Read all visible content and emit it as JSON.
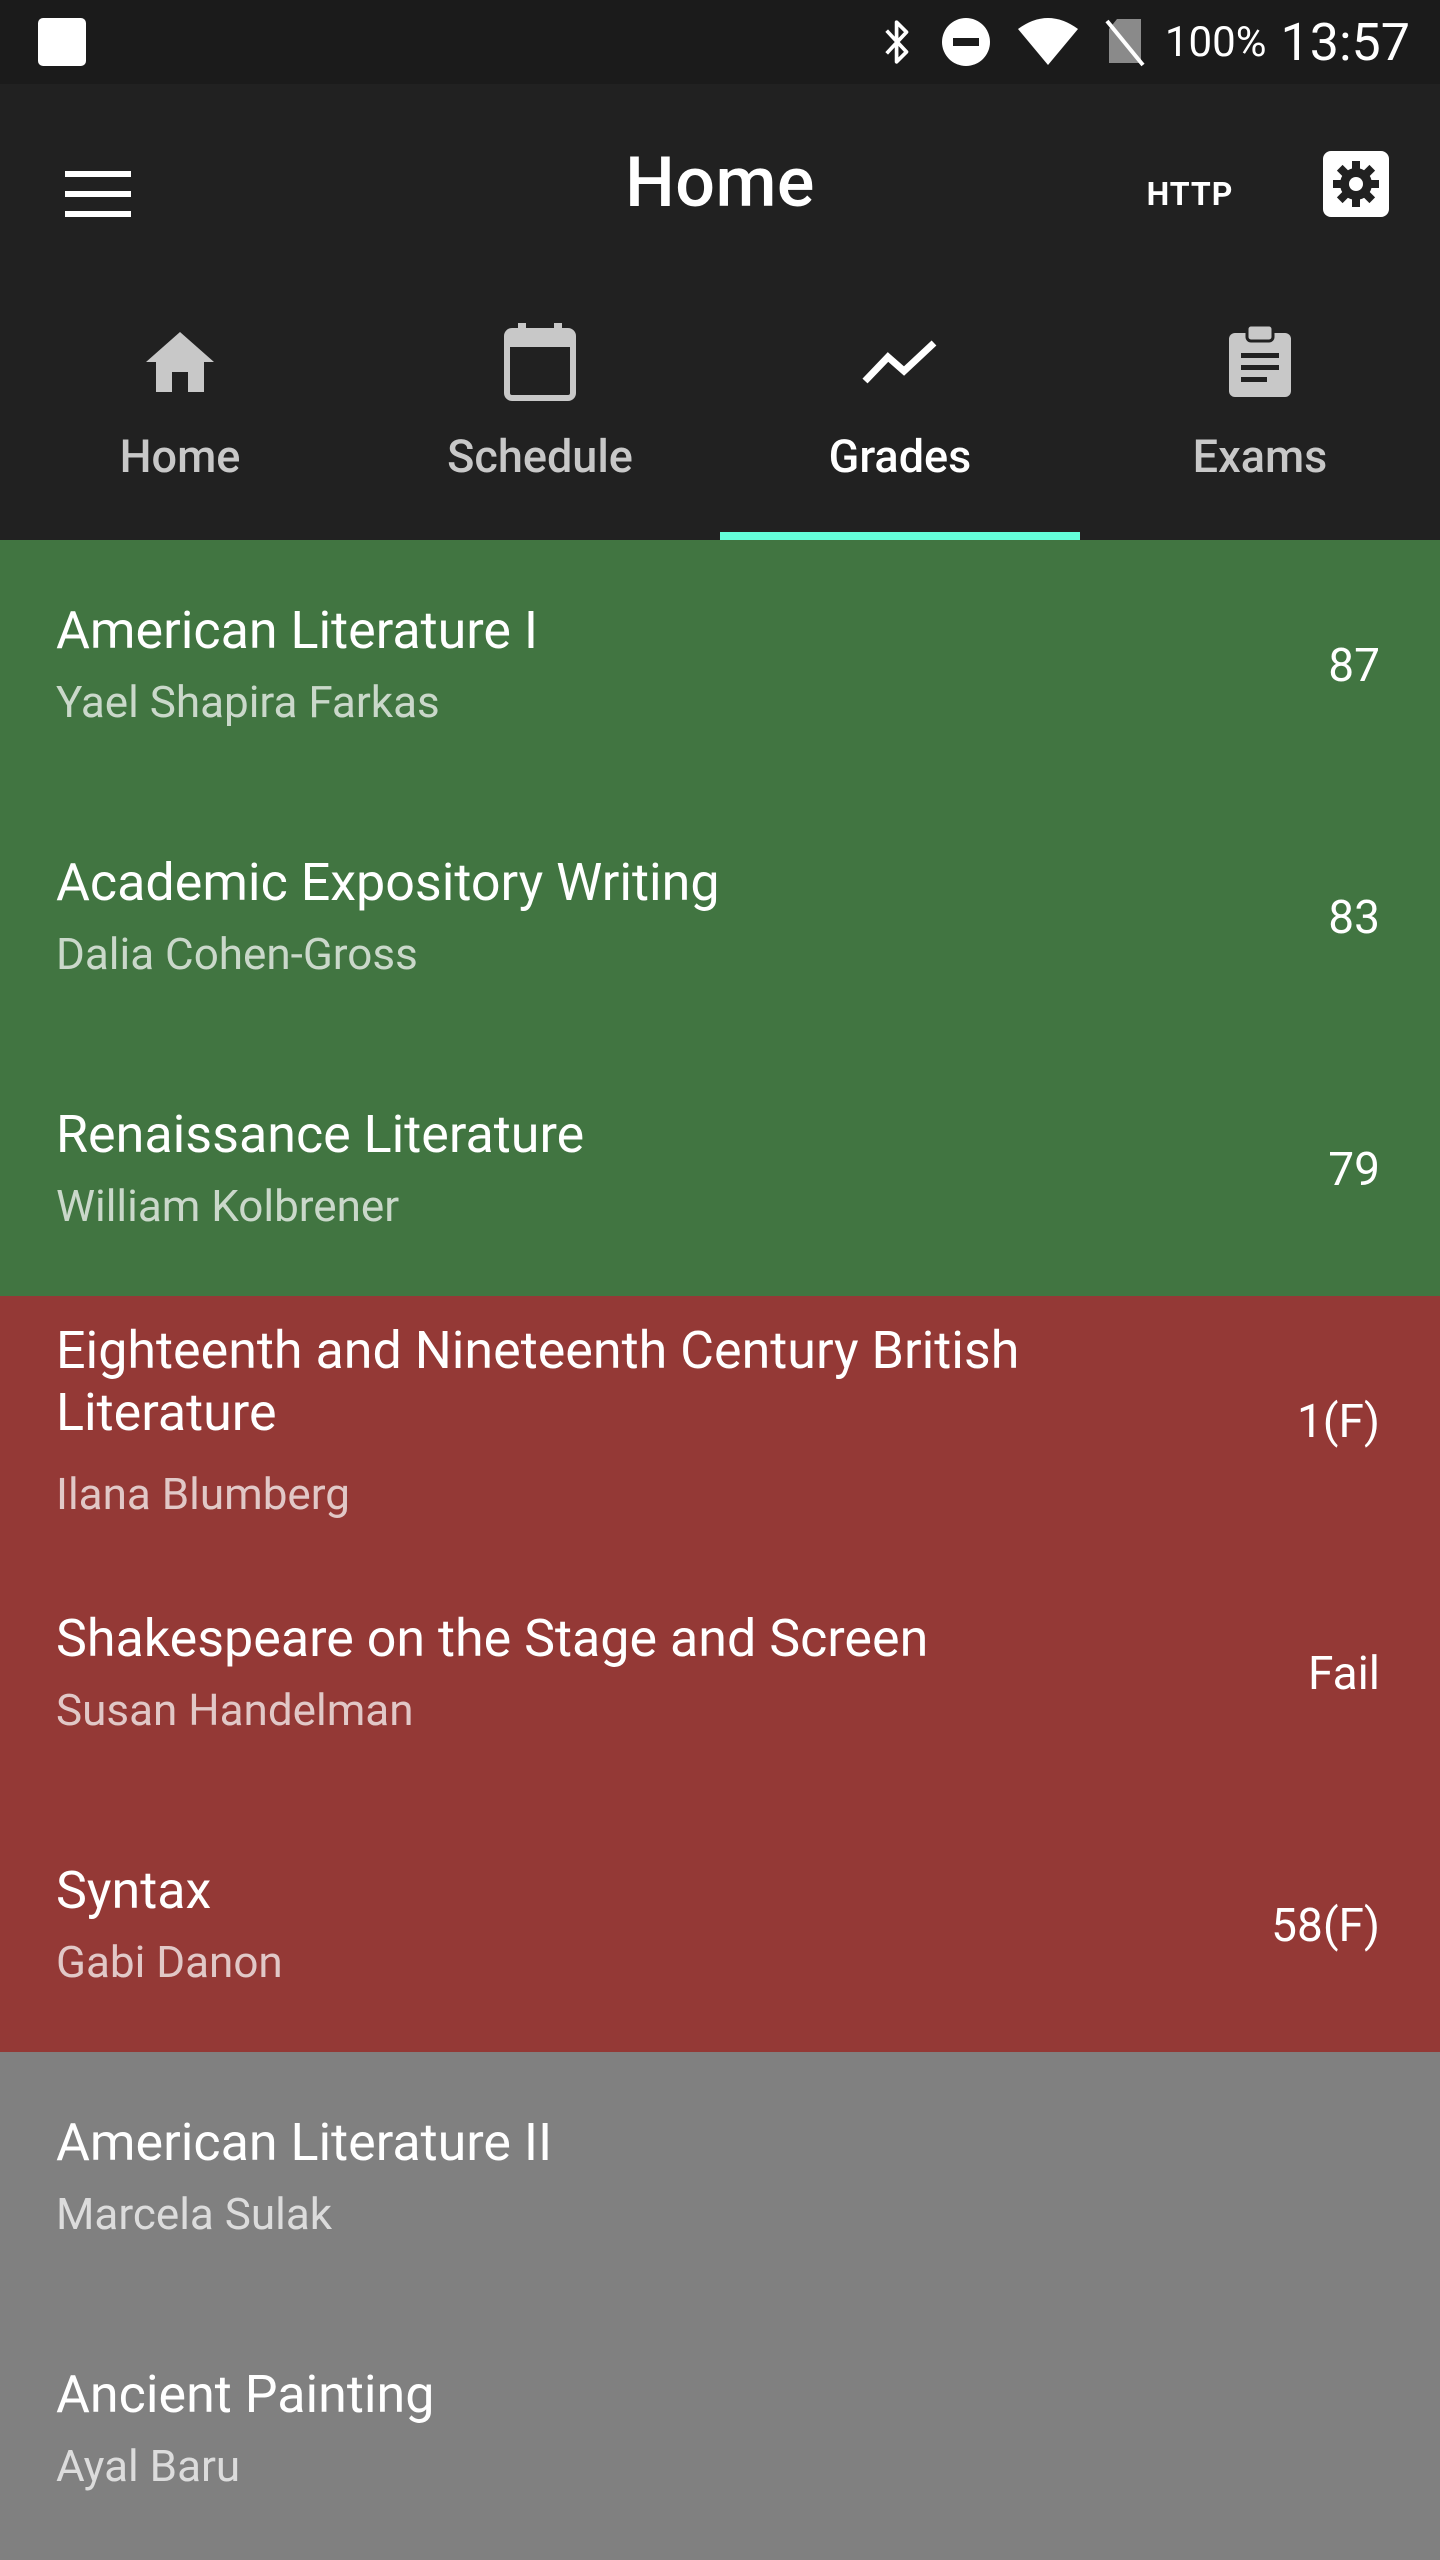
{
  "status_bar": {
    "battery": "100%",
    "time": "13:57",
    "icons": [
      "notification-square-icon",
      "bluetooth-icon",
      "do-not-disturb-icon",
      "wifi-icon",
      "no-sim-icon"
    ]
  },
  "app_bar": {
    "title": "Home",
    "http_label": "HTTP"
  },
  "tabs": [
    {
      "label": "Home",
      "icon": "home-icon"
    },
    {
      "label": "Schedule",
      "icon": "calendar-icon"
    },
    {
      "label": "Grades",
      "icon": "trending-up-icon",
      "active": true
    },
    {
      "label": "Exams",
      "icon": "clipboard-icon"
    }
  ],
  "colors": {
    "pass": "#417541",
    "fail": "#943936",
    "pending": "#808080",
    "tab_indicator": "#64ffda",
    "app_bar": "#212121"
  },
  "grades": [
    {
      "course": "American Literature I",
      "lecturer": "Yael Shapira Farkas",
      "grade": "87",
      "status": "pass"
    },
    {
      "course": "Academic Expository Writing",
      "lecturer": "Dalia Cohen-Gross",
      "grade": "83",
      "status": "pass"
    },
    {
      "course": "Renaissance Literature",
      "lecturer": "William Kolbrener",
      "grade": "79",
      "status": "pass"
    },
    {
      "course": "Eighteenth and Nineteenth Century British Literature",
      "lecturer": "Ilana Blumberg",
      "grade": "1(F)",
      "status": "fail"
    },
    {
      "course": "Shakespeare on the Stage and Screen",
      "lecturer": "Susan Handelman",
      "grade": "Fail",
      "status": "fail"
    },
    {
      "course": "Syntax",
      "lecturer": "Gabi Danon",
      "grade": "58(F)",
      "status": "fail"
    },
    {
      "course": "American Literature II",
      "lecturer": "Marcela Sulak",
      "grade": "",
      "status": "pending"
    },
    {
      "course": "Ancient Painting",
      "lecturer": "Ayal Baru",
      "grade": "",
      "status": "pending"
    }
  ]
}
